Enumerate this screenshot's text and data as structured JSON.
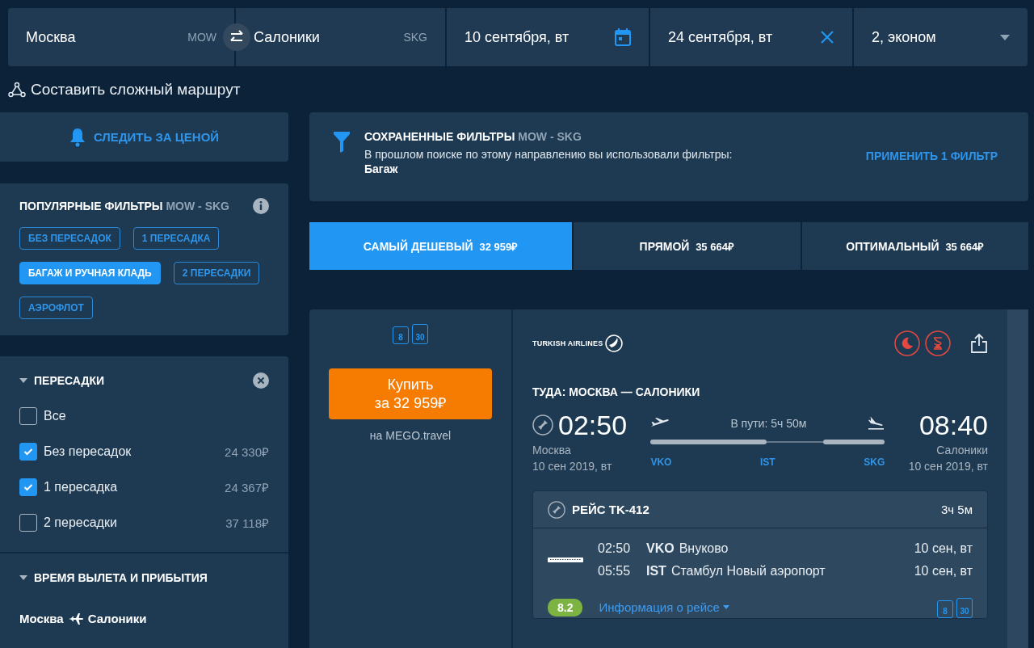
{
  "search": {
    "origin": {
      "city": "Москва",
      "code": "MOW"
    },
    "destination": {
      "city": "Салоники",
      "code": "SKG"
    },
    "depart_date": "10 сентября, вт",
    "return_date": "24 сентября, вт",
    "passengers": "2, эконом"
  },
  "complex_route_link": "Составить сложный маршрут",
  "price_alert": "СЛЕДИТЬ ЗА ЦЕНОЙ",
  "popular_filters": {
    "title": "ПОПУЛЯРНЫЕ ФИЛЬТРЫ",
    "route": "MOW - SKG",
    "chips": [
      {
        "label": "БЕЗ ПЕРЕСАДОК",
        "selected": false
      },
      {
        "label": "1 ПЕРЕСАДКА",
        "selected": false
      },
      {
        "label": "БАГАЖ И РУЧНАЯ КЛАДЬ",
        "selected": true
      },
      {
        "label": "2 ПЕРЕСАДКИ",
        "selected": false
      },
      {
        "label": "АЭРОФЛОТ",
        "selected": false
      }
    ]
  },
  "transfers": {
    "title": "ПЕРЕСАДКИ",
    "expanded": true,
    "options": [
      {
        "label": "Все",
        "checked": false
      },
      {
        "label": "Без пересадок",
        "checked": true,
        "price": "24 330₽"
      },
      {
        "label": "1 пересадка",
        "checked": true,
        "price": "24 367₽"
      },
      {
        "label": "2 пересадки",
        "checked": false,
        "price": "37 118₽"
      }
    ]
  },
  "times": {
    "title": "ВРЕМЯ ВЫЛЕТА И ПРИБЫТИЯ",
    "expanded": true,
    "route_from": "Москва",
    "route_to": "Салоники"
  },
  "saved_filters": {
    "title": "СОХРАНЕННЫЕ ФИЛЬТРЫ",
    "route": "MOW - SKG",
    "text": "В прошлом поиске по этому направлению вы использовали фильтры:",
    "filters": "Багаж",
    "apply": "ПРИМЕНИТЬ 1 ФИЛЬТР"
  },
  "sort_tabs": [
    {
      "label": "САМЫЙ ДЕШЕВЫЙ",
      "price": "32 959₽",
      "selected": true
    },
    {
      "label": "ПРЯМОЙ",
      "price": "35 664₽",
      "selected": false
    },
    {
      "label": "ОПТИМАЛЬНЫЙ",
      "price": "35 664₽",
      "selected": false
    }
  ],
  "ticket": {
    "baggage": [
      {
        "kind": "hand",
        "weight": "8"
      },
      {
        "kind": "checked",
        "weight": "30"
      }
    ],
    "buy_line1": "Купить",
    "buy_line2": "за 32 959₽",
    "seller": "на MEGO.travel",
    "airline": "TURKISH AIRLINES",
    "badges": [
      {
        "kind": "night"
      },
      {
        "kind": "long-wait"
      }
    ],
    "direction": "ТУДА: МОСКВА — САЛОНИКИ",
    "depart_time": "02:50",
    "depart_city": "Москва",
    "depart_date": "10 сен 2019, вт",
    "duration": "В пути: 5ч 50м",
    "arrive_time": "08:40",
    "arrive_city": "Салоники",
    "arrive_date": "10 сен 2019, вт",
    "stops": [
      "VKO",
      "IST",
      "SKG"
    ],
    "segment": {
      "title": "РЕЙС TK-412",
      "duration": "3ч 5м",
      "legs": [
        {
          "time": "02:50",
          "code": "VKO",
          "airport": "Внуково",
          "date": "10 сен, вт"
        },
        {
          "time": "05:55",
          "code": "IST",
          "airport": "Стамбул Новый аэропорт",
          "date": "10 сен, вт"
        }
      ],
      "rating": "8.2",
      "info_link": "Информация о рейсе",
      "baggage": [
        {
          "kind": "hand",
          "weight": "8"
        },
        {
          "kind": "checked",
          "weight": "30"
        }
      ]
    }
  }
}
